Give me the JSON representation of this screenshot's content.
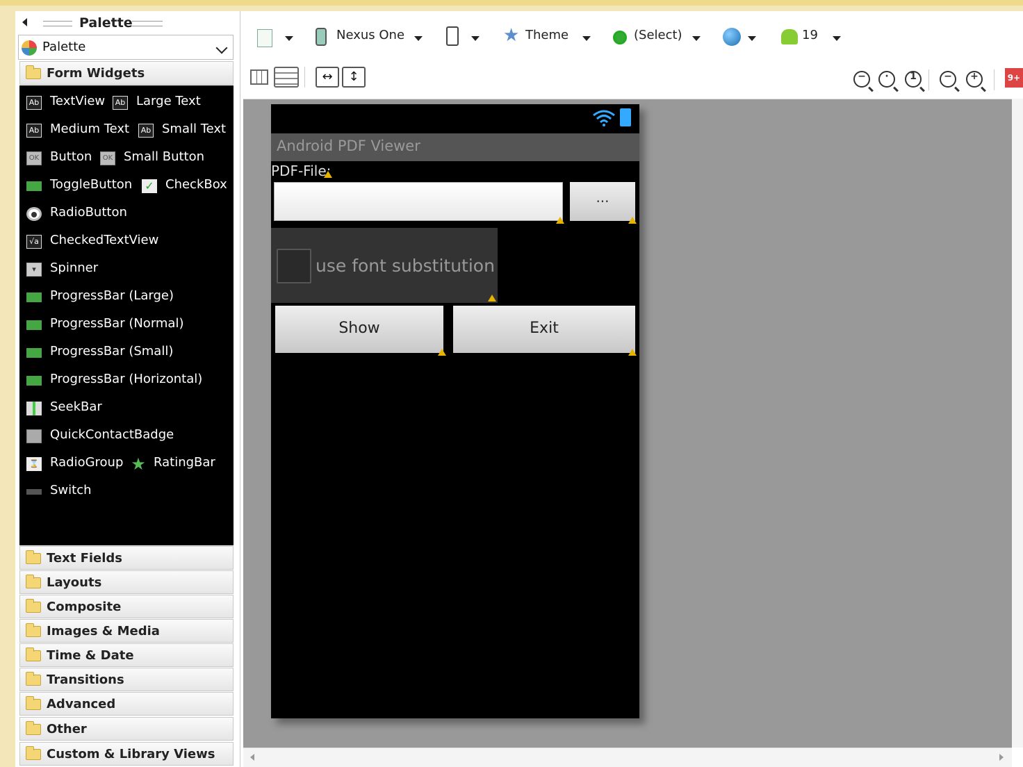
{
  "palette": {
    "header_title": "Palette",
    "selector_label": "Palette",
    "form_widgets_label": "Form Widgets",
    "widgets": [
      {
        "label": "TextView",
        "icon": "Ab"
      },
      {
        "label": "Large Text",
        "icon": "Ab"
      },
      {
        "label": "Medium Text",
        "icon": "Ab"
      },
      {
        "label": "Small Text",
        "icon": "Ab"
      },
      {
        "label": "Button",
        "icon": "OK"
      },
      {
        "label": "Small Button",
        "icon": "OK"
      },
      {
        "label": "ToggleButton",
        "icon": "toggle-icon"
      },
      {
        "label": "CheckBox",
        "icon": "check-icon"
      },
      {
        "label": "RadioButton",
        "icon": "radio-icon"
      },
      {
        "label": "CheckedTextView",
        "icon": "checked-text-icon"
      },
      {
        "label": "Spinner",
        "icon": "spinner-icon"
      },
      {
        "label": "ProgressBar (Large)",
        "icon": "progress-icon"
      },
      {
        "label": "ProgressBar (Normal)",
        "icon": "progress-icon"
      },
      {
        "label": "ProgressBar (Small)",
        "icon": "progress-icon"
      },
      {
        "label": "ProgressBar (Horizontal)",
        "icon": "progress-icon"
      },
      {
        "label": "SeekBar",
        "icon": "seekbar-icon"
      },
      {
        "label": "QuickContactBadge",
        "icon": "contact-badge-icon"
      },
      {
        "label": "RadioGroup",
        "icon": "radio-group-icon"
      },
      {
        "label": "RatingBar",
        "icon": "star-icon"
      },
      {
        "label": "Switch",
        "icon": "switch-icon"
      }
    ],
    "categories": [
      "Text Fields",
      "Layouts",
      "Composite",
      "Images & Media",
      "Time & Date",
      "Transitions",
      "Advanced",
      "Other",
      "Custom & Library Views"
    ]
  },
  "toolbar": {
    "device": "Nexus One",
    "theme": "Theme",
    "activity": "(Select)",
    "api_level": "19",
    "notification_badge": "9+"
  },
  "device_screen": {
    "app_title": "Android PDF Viewer",
    "file_label": "PDF-File:",
    "file_value": "",
    "browse_label": "...",
    "checkbox_label": "use font substitution",
    "show_label": "Show",
    "exit_label": "Exit"
  },
  "colors": {
    "widget_panel_bg": "#000000",
    "canvas_bg": "#999999",
    "title_bar_bg": "#555555",
    "warning": "#e6b400"
  }
}
